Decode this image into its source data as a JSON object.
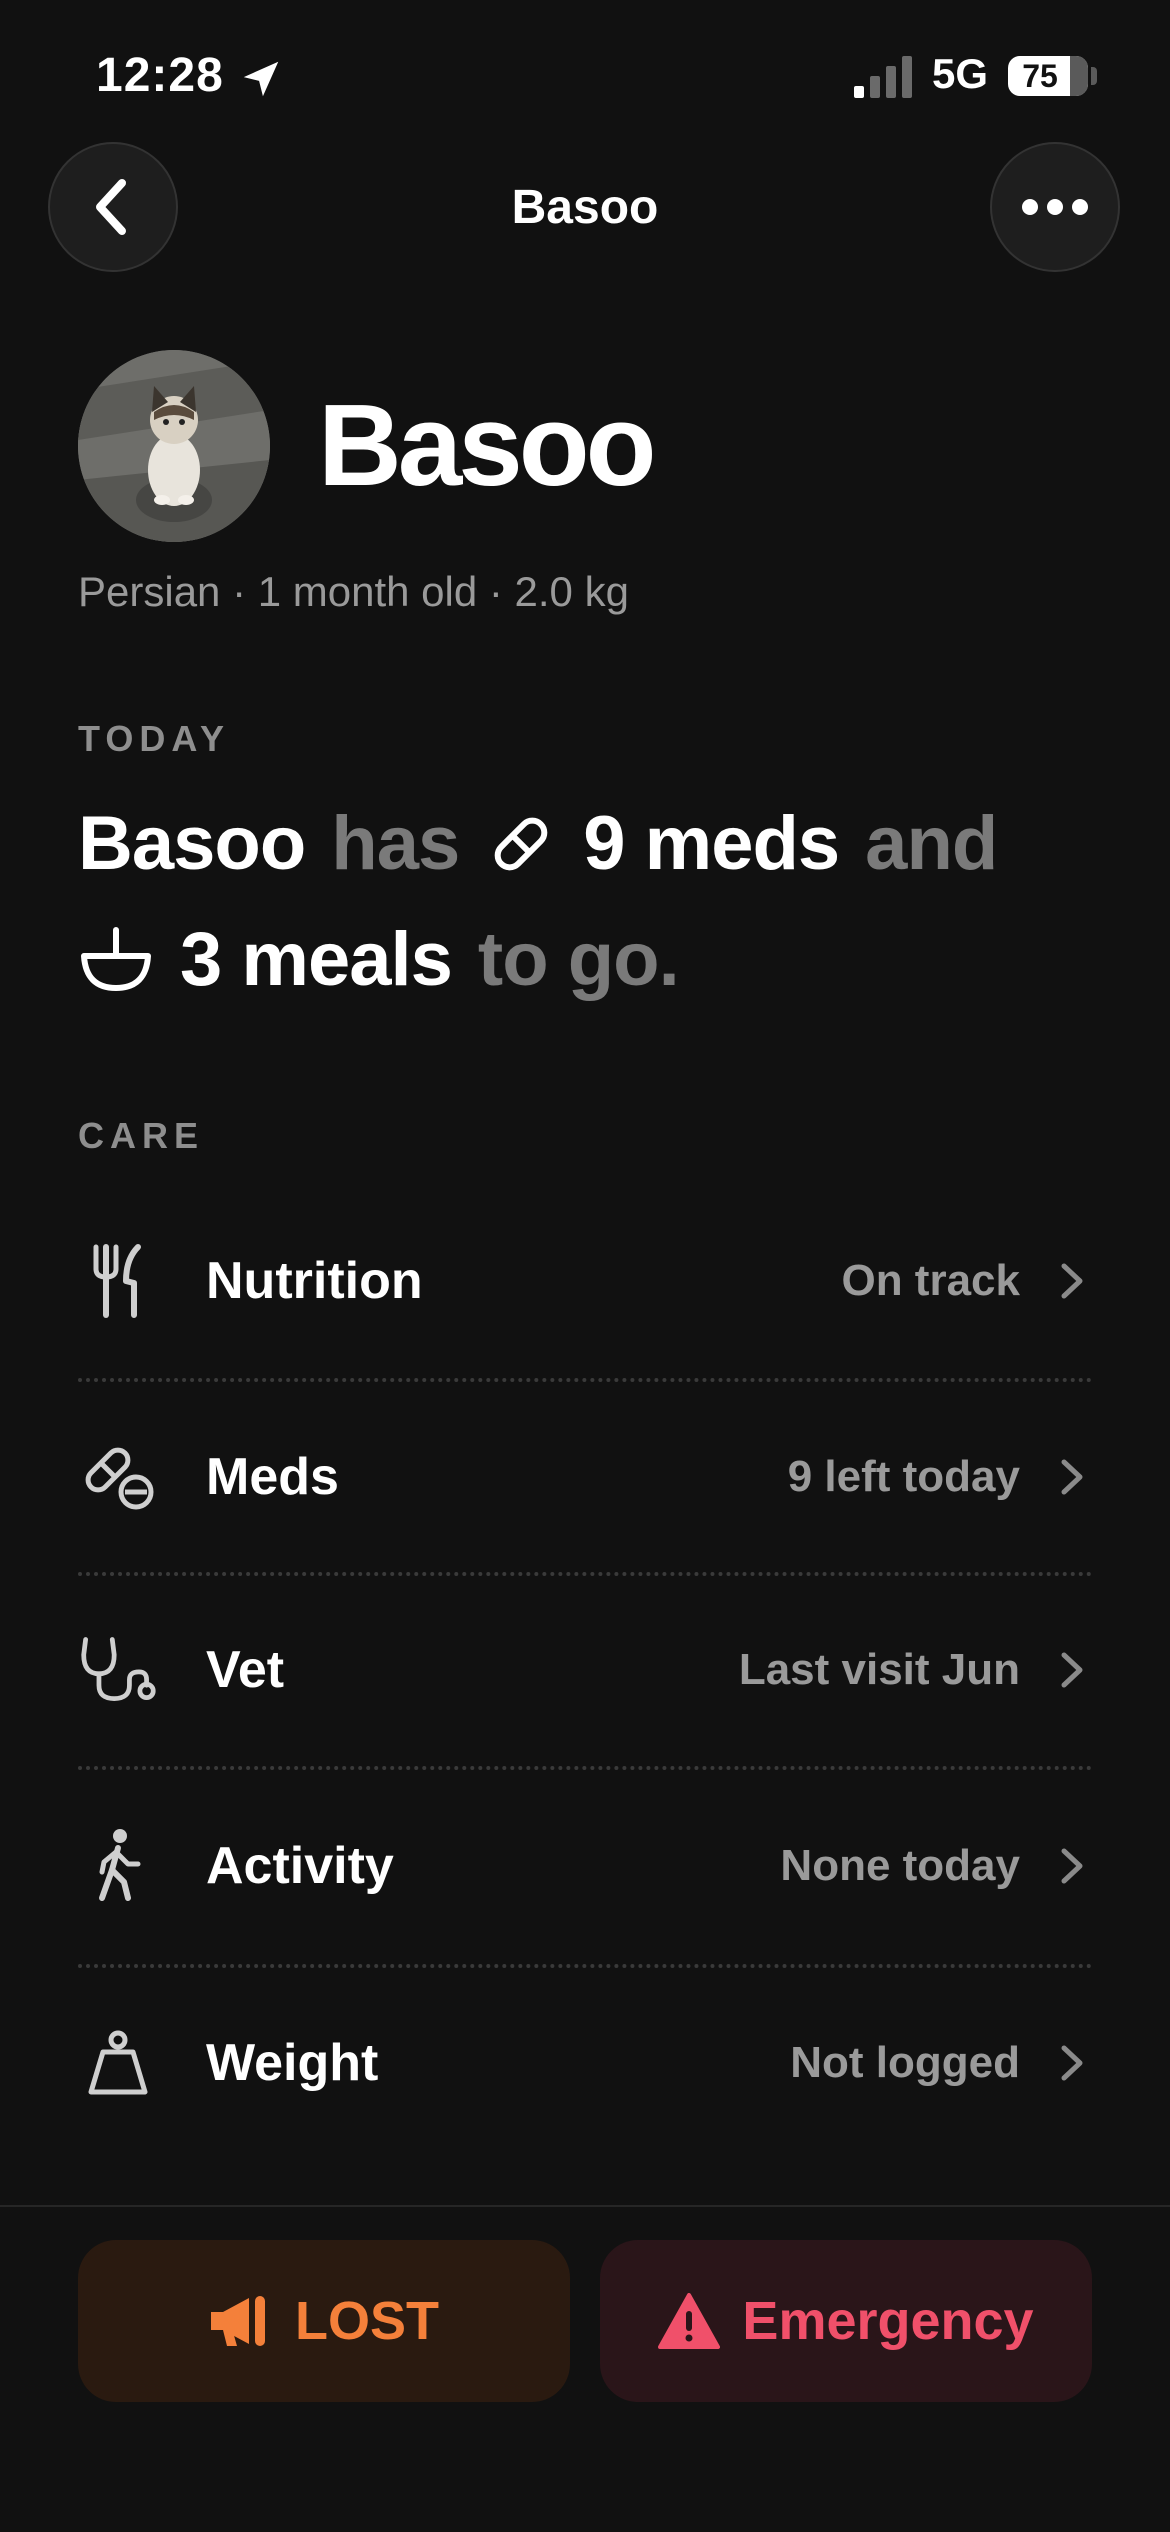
{
  "status_bar": {
    "time": "12:28",
    "network": "5G",
    "battery": "75"
  },
  "nav": {
    "title": "Basoo"
  },
  "profile": {
    "name": "Basoo",
    "meta": "Persian · 1 month old · 2.0 kg"
  },
  "today": {
    "section_label": "TODAY",
    "pet_name": "Basoo",
    "has": "has",
    "meds": "9 meds",
    "and": "and",
    "meals": "3 meals",
    "to_go": "to go."
  },
  "care": {
    "section_label": "CARE",
    "items": [
      {
        "label": "Nutrition",
        "status": "On track",
        "icon": "fork-knife-icon"
      },
      {
        "label": "Meds",
        "status": "9 left today",
        "icon": "pills-icon"
      },
      {
        "label": "Vet",
        "status": "Last visit Jun",
        "icon": "stethoscope-icon"
      },
      {
        "label": "Activity",
        "status": "None today",
        "icon": "walking-person-icon"
      },
      {
        "label": "Weight",
        "status": "Not logged",
        "icon": "scale-weight-icon"
      }
    ]
  },
  "actions": {
    "lost": "LOST",
    "emergency": "Emergency"
  },
  "colors": {
    "background": "#111111",
    "lost": "#f4803a",
    "emergency": "#f0506a"
  }
}
